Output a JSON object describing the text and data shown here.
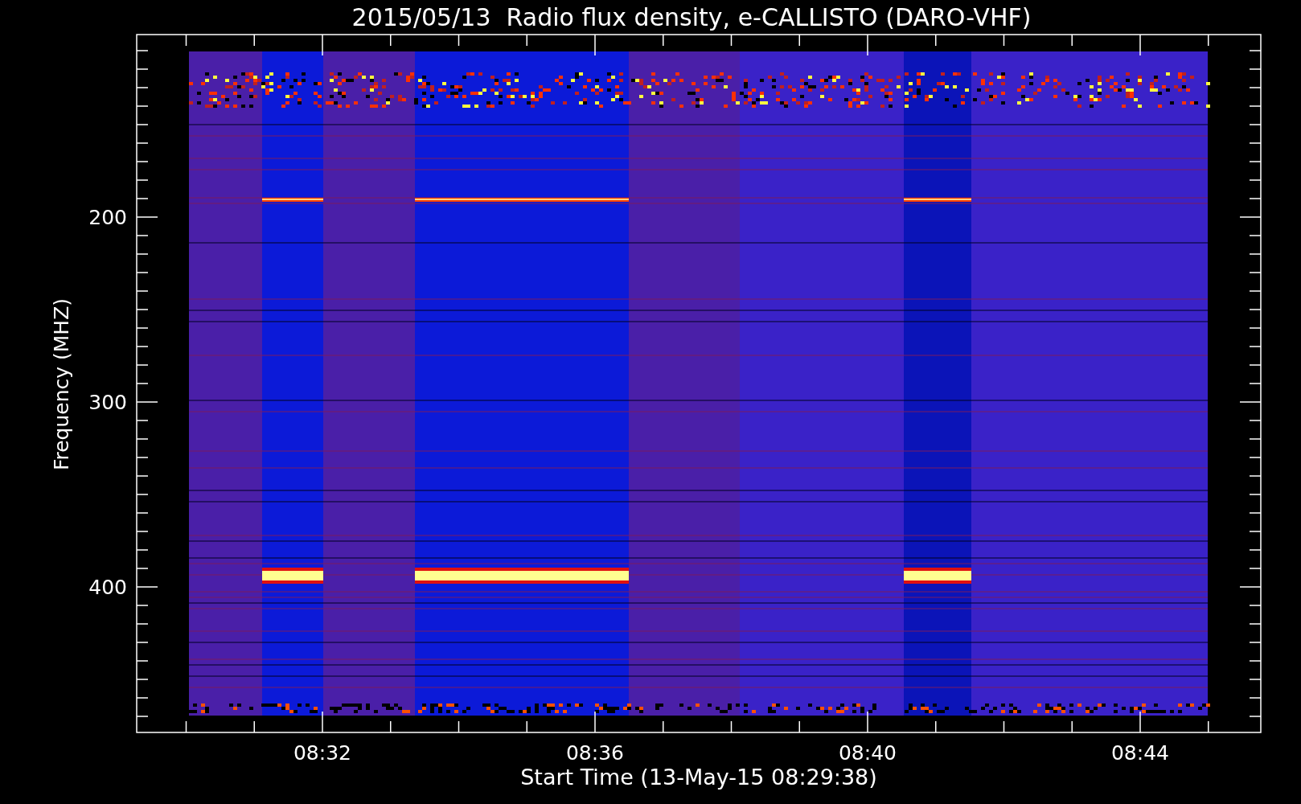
{
  "title": "2015/05/13  Radio flux density, e-CALLISTO (DARO-VHF)",
  "plot": {
    "ylabel": "Frequency (MHZ)",
    "xlabel": "Start Time (13-May-15 08:29:38)",
    "yticks": [
      "200",
      "300",
      "400"
    ],
    "xticks": [
      "08:32",
      "08:36",
      "08:40",
      "08:44"
    ]
  }
}
